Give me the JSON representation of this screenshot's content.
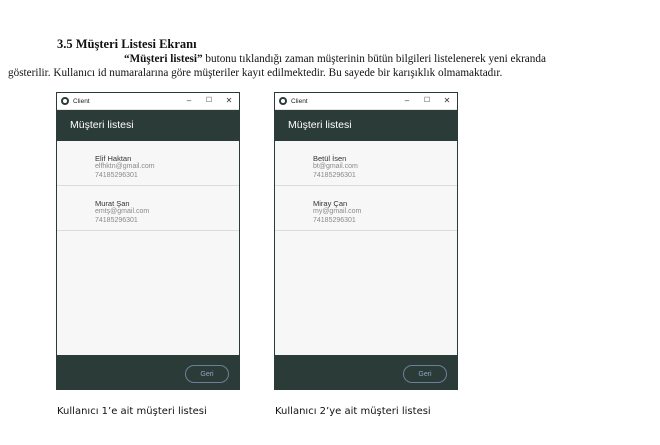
{
  "section": {
    "heading": "3.5 Müşteri Listesi Ekranı",
    "button_name": "“Müşteri listesi”",
    "line1_rest": " butonu tıklandığı zaman müşterinin bütün bilgileri listelenerek yeni ekranda",
    "line2": "gösterilir. Kullanıcı id numaralarına göre müşteriler kayıt edilmektedir. Bu sayede bir karışıklık olmamaktadır."
  },
  "windows": [
    {
      "window_title": "Client",
      "app_title": "Müşteri listesi",
      "customers": [
        {
          "name": "Elif Haktan",
          "email": "elfhktn@gmail.com",
          "phone": "74185296301"
        },
        {
          "name": "Murat Şan",
          "email": "emtş@gmail.com",
          "phone": "74185296301"
        }
      ],
      "back_label": "Geri",
      "caption": "Kullanıcı 1’e ait müşteri listesi"
    },
    {
      "window_title": "Client",
      "app_title": "Müşteri listesi",
      "customers": [
        {
          "name": "Betül İsen",
          "email": "bt@gmail.com",
          "phone": "74185296301"
        },
        {
          "name": "Miray Çan",
          "email": "my@gmail.com",
          "phone": "74185296301"
        }
      ],
      "back_label": "Geri",
      "caption": "Kullanıcı 2’ye ait müşteri listesi"
    }
  ],
  "controls": {
    "minimize": "–",
    "maximize": "☐",
    "close": "✕"
  },
  "colors": {
    "app_dark": "#2b3c38",
    "back_button_text": "#8fa6c8",
    "list_background": "#f7f7f7"
  }
}
